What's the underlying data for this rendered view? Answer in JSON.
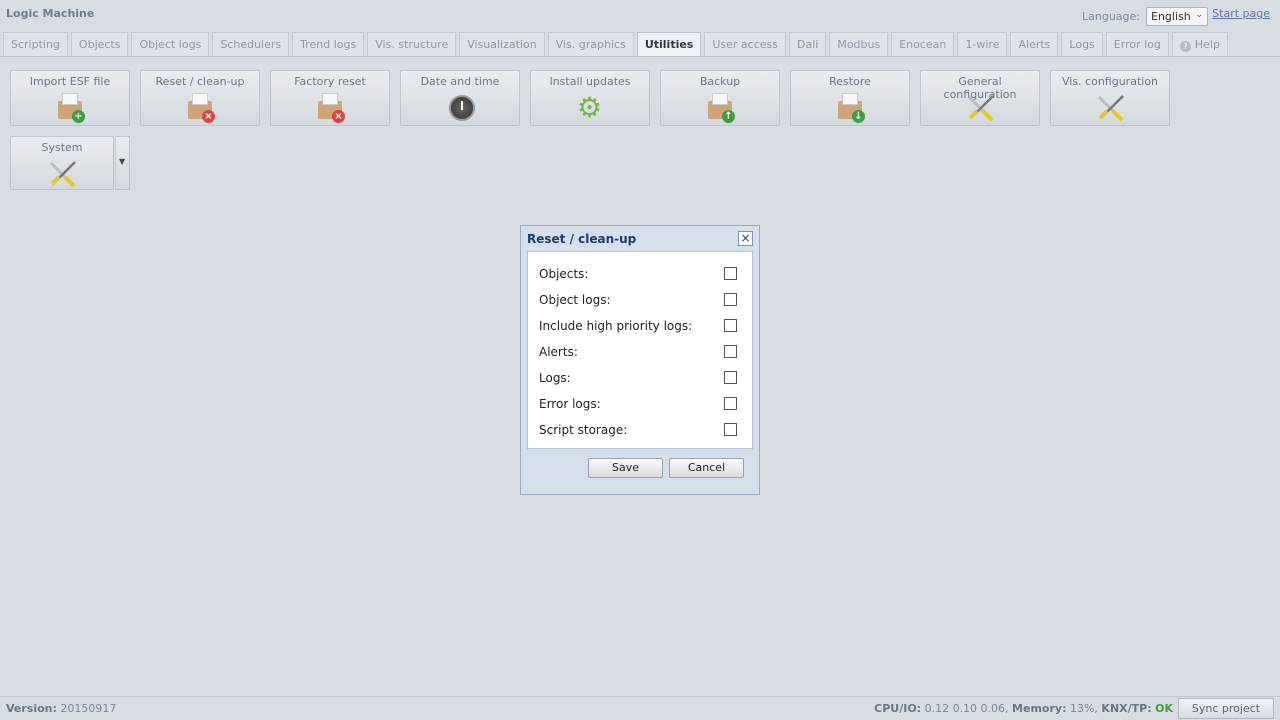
{
  "app": {
    "title": "Logic Machine"
  },
  "header": {
    "language_label": "Language:",
    "language_value": "English",
    "start_page_link": "Start page"
  },
  "tabs": [
    {
      "label": "Scripting"
    },
    {
      "label": "Objects"
    },
    {
      "label": "Object logs"
    },
    {
      "label": "Schedulers"
    },
    {
      "label": "Trend logs"
    },
    {
      "label": "Vis. structure"
    },
    {
      "label": "Visualization"
    },
    {
      "label": "Vis. graphics"
    },
    {
      "label": "Utilities",
      "active": true
    },
    {
      "label": "User access"
    },
    {
      "label": "Dali"
    },
    {
      "label": "Modbus"
    },
    {
      "label": "Enocean"
    },
    {
      "label": "1-wire"
    },
    {
      "label": "Alerts"
    },
    {
      "label": "Logs"
    },
    {
      "label": "Error log"
    },
    {
      "label": "Help",
      "icon": "help-icon"
    }
  ],
  "utilities": [
    {
      "label": "Import ESF file",
      "icon": "box-add-icon"
    },
    {
      "label": "Reset / clean-up",
      "icon": "box-remove-icon"
    },
    {
      "label": "Factory reset",
      "icon": "box-remove-icon"
    },
    {
      "label": "Date and time",
      "icon": "clock-icon"
    },
    {
      "label": "Install updates",
      "icon": "gear-refresh-icon"
    },
    {
      "label": "Backup",
      "icon": "box-upload-icon"
    },
    {
      "label": "Restore",
      "icon": "box-download-icon"
    },
    {
      "label": "General configuration",
      "icon": "tools-icon"
    },
    {
      "label": "Vis. configuration",
      "icon": "tools-icon"
    },
    {
      "label": "System",
      "icon": "tools-icon",
      "has_dropdown": true
    }
  ],
  "dialog": {
    "title": "Reset / clean-up",
    "options": [
      {
        "label": "Objects:",
        "checked": false
      },
      {
        "label": "Object logs:",
        "checked": false
      },
      {
        "label": "Include high priority logs:",
        "checked": false
      },
      {
        "label": "Alerts:",
        "checked": false
      },
      {
        "label": "Logs:",
        "checked": false
      },
      {
        "label": "Error logs:",
        "checked": false
      },
      {
        "label": "Script storage:",
        "checked": false
      }
    ],
    "save_label": "Save",
    "cancel_label": "Cancel"
  },
  "footer": {
    "version_label": "Version:",
    "version_value": "20150917",
    "cpu_label": "CPU/IO:",
    "cpu_value": "0.12 0.10 0.06,",
    "memory_label": "Memory:",
    "memory_value": "13%,",
    "knx_label": "KNX/TP:",
    "knx_value": "OK",
    "sync_button": "Sync project data"
  },
  "colors": {
    "background": "#d8dde4",
    "dialog_title": "#1d3b73",
    "status_ok": "#3b9e3b"
  }
}
